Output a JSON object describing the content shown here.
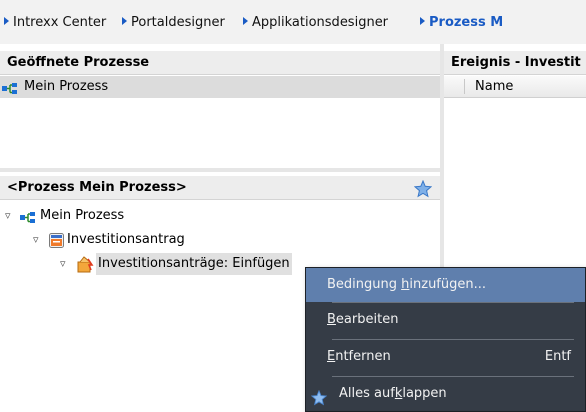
{
  "nav": {
    "items": [
      {
        "label": "Intrexx Center"
      },
      {
        "label": "Portaldesigner"
      },
      {
        "label": "Applikationsdesigner"
      },
      {
        "label": "Prozess M"
      }
    ]
  },
  "open_processes": {
    "header": "Geöffnete Prozesse",
    "items": [
      {
        "label": "Mein Prozess"
      }
    ]
  },
  "event_panel": {
    "header": "Ereignis - Investit",
    "column_name": "Name"
  },
  "process_tree": {
    "header": "<Prozess Mein Prozess>",
    "root": {
      "label": "Mein Prozess"
    },
    "child": {
      "label": "Investitionsantrag"
    },
    "grandchild": {
      "label": "Investitionsanträge: Einfügen"
    }
  },
  "context_menu": {
    "items": [
      {
        "pre": "Bedingung ",
        "mn": "h",
        "post": "inzufügen..."
      },
      {
        "pre": "",
        "mn": "B",
        "post": "earbeiten"
      },
      {
        "pre": "",
        "mn": "E",
        "post": "ntfernen",
        "shortcut": "Entf"
      },
      {
        "pre": "Alles auf",
        "mn": "k",
        "post": "lappen"
      }
    ]
  },
  "colors": {
    "accent": "#1a5bc4",
    "menu_bg": "#353c46",
    "menu_hover": "#5f7fad"
  }
}
